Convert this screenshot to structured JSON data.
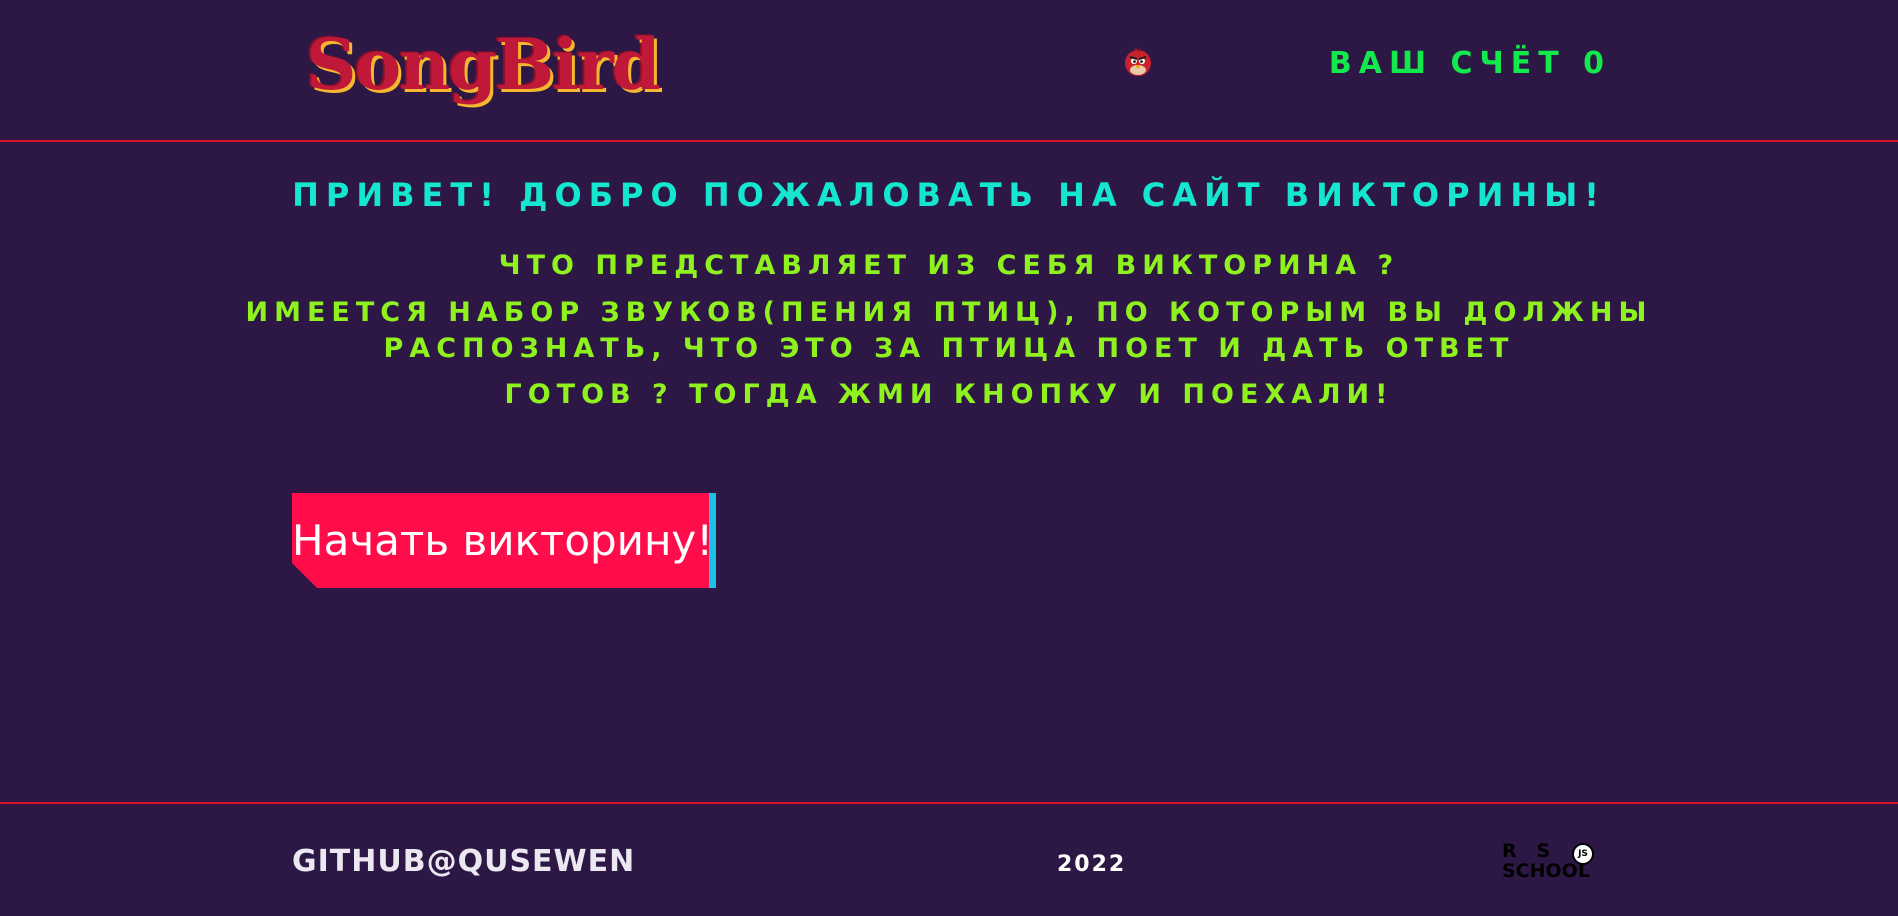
{
  "header": {
    "logo_text": "SongBird",
    "bird_icon": "angry-red-bird-icon",
    "score_label": "ВАШ СЧЁТ",
    "score_value": "0"
  },
  "main": {
    "welcome": "ПРИВЕТ! ДОБРО ПОЖАЛОВАТЬ НА САЙТ ВИКТОРИНЫ!",
    "question": "ЧТО ПРЕДСТАВЛЯЕТ ИЗ СЕБЯ ВИКТОРИНА ?",
    "description_line1": "ИМЕЕТСЯ НАБОР ЗВУКОВ(ПЕНИЯ ПТИЦ), ПО КОТОРЫМ ВЫ ДОЛЖНЫ",
    "description_line2": "РАСПОЗНАТЬ, ЧТО ЭТО ЗА ПТИЦА ПОЕТ И ДАТЬ ОТВЕТ",
    "call_to_action": "ГОТОВ ? ТОГДА ЖМИ КНОПКУ И ПОЕХАЛИ!",
    "start_button_label": "Начать викторину!"
  },
  "footer": {
    "github_link": "GITHUB@QUSEWEN",
    "year": "2022",
    "rs_logo_row1": "R   S",
    "rs_logo_row2": "SCHOOL",
    "rs_logo_badge": "JS"
  },
  "colors": {
    "background": "#2d1745",
    "divider": "#d4122a",
    "score": "#13e84d",
    "welcome": "#15e6cf",
    "description": "#8ff21f",
    "button": "#ff0d4b",
    "button_accent": "#19c2e6"
  }
}
